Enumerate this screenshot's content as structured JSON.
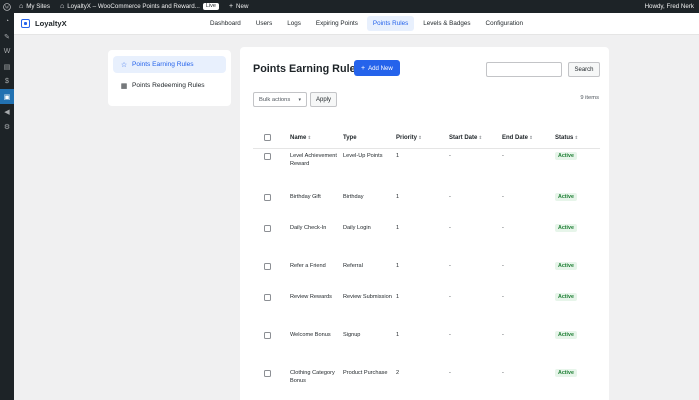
{
  "adminbar": {
    "my_sites": "My Sites",
    "site_title": "LoyaltyX – WooCommerce Points and Reward...",
    "live_badge": "Live",
    "new_label": "New",
    "howdy": "Howdy, Fred Nerk"
  },
  "brand": {
    "name": "LoyaltyX"
  },
  "nav": {
    "tabs": [
      {
        "label": "Dashboard"
      },
      {
        "label": "Users"
      },
      {
        "label": "Logs"
      },
      {
        "label": "Expiring Points"
      },
      {
        "label": "Points Rules"
      },
      {
        "label": "Levels & Badges"
      },
      {
        "label": "Configuration"
      }
    ],
    "active": "Points Rules"
  },
  "leftnav": {
    "items": [
      {
        "label": "Points Earning Rules",
        "icon": "star-icon"
      },
      {
        "label": "Points Redeeming Rules",
        "icon": "gift-icon"
      }
    ]
  },
  "main": {
    "title": "Points Earning Rules",
    "add_new": "Add New",
    "search_placeholder": "",
    "search_button": "Search",
    "bulk_actions": "Bulk actions",
    "apply": "Apply",
    "item_count": "9 items"
  },
  "table": {
    "columns": {
      "name": "Name",
      "type": "Type",
      "priority": "Priority",
      "start_date": "Start Date",
      "end_date": "End Date",
      "status": "Status"
    },
    "rows": [
      {
        "name": "Level Achievement Reward",
        "type": "Level-Up Points",
        "priority": "1",
        "start": "-",
        "end": "-",
        "status": "Active"
      },
      {
        "name": "Birthday Gift",
        "type": "Birthday",
        "priority": "1",
        "start": "-",
        "end": "-",
        "status": "Active"
      },
      {
        "name": "Daily Check-In",
        "type": "Daily Login",
        "priority": "1",
        "start": "-",
        "end": "-",
        "status": "Active"
      },
      {
        "name": "Refer a Friend",
        "type": "Referral",
        "priority": "1",
        "start": "-",
        "end": "-",
        "status": "Active"
      },
      {
        "name": "Review Rewards",
        "type": "Review Submission",
        "priority": "1",
        "start": "-",
        "end": "-",
        "status": "Active"
      },
      {
        "name": "Welcome Bonus",
        "type": "Signup",
        "priority": "1",
        "start": "-",
        "end": "-",
        "status": "Active"
      },
      {
        "name": "Clothing Category Bonus",
        "type": "Product Purchase",
        "priority": "2",
        "start": "-",
        "end": "-",
        "status": "Active"
      }
    ]
  },
  "colors": {
    "accent": "#2563eb",
    "adminbar": "#1d2327",
    "active_badge_bg": "#e7f5ea",
    "active_badge_text": "#1e7e34"
  }
}
